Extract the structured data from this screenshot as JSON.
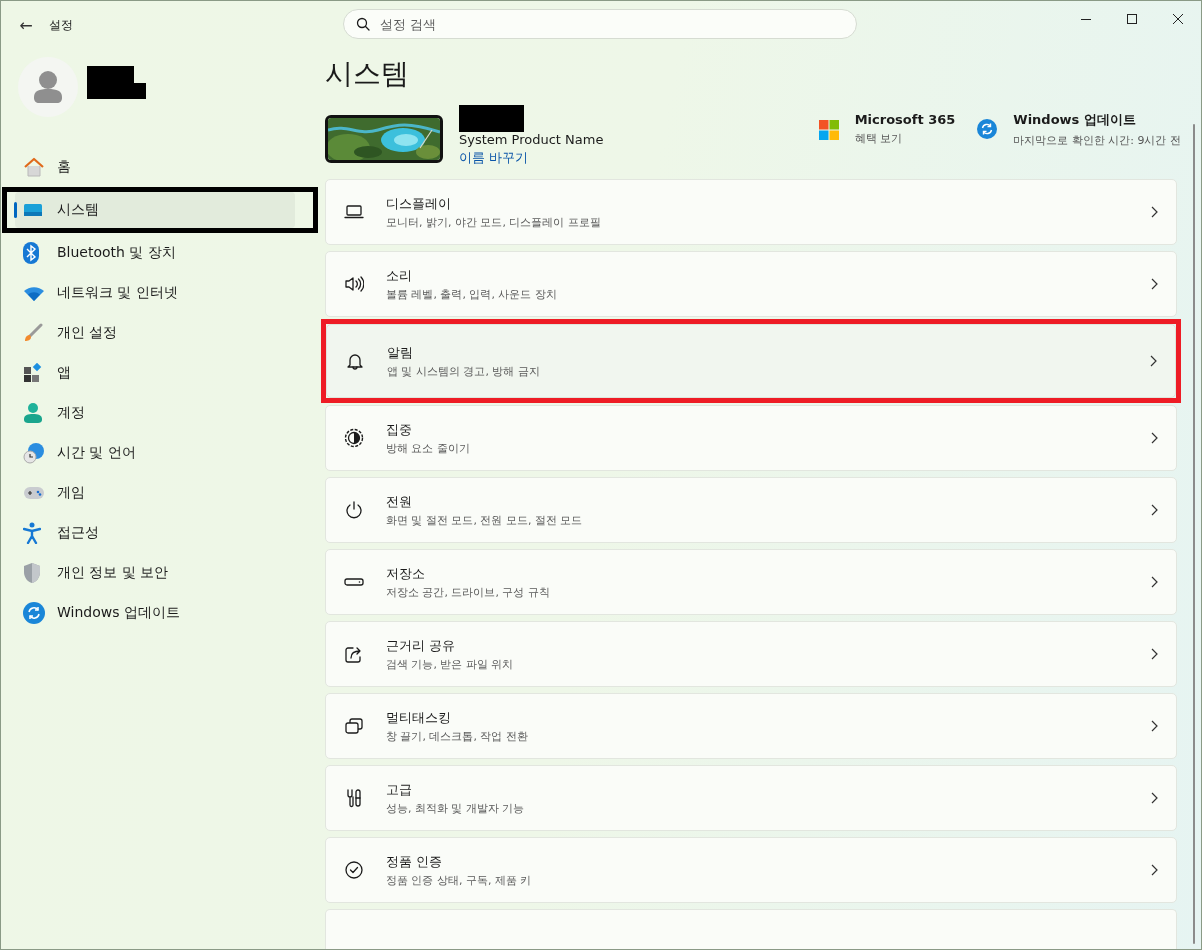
{
  "window": {
    "title": "설정",
    "back_button": "←"
  },
  "search": {
    "placeholder": "설정 검색"
  },
  "user": {
    "redacted": true
  },
  "sidebar": {
    "items": [
      {
        "label": "홈",
        "selected": false,
        "outlined": false
      },
      {
        "label": "시스템",
        "selected": true,
        "outlined": true
      },
      {
        "label": "Bluetooth 및 장치",
        "selected": false,
        "outlined": false
      },
      {
        "label": "네트워크 및 인터넷",
        "selected": false,
        "outlined": false
      },
      {
        "label": "개인 설정",
        "selected": false,
        "outlined": false
      },
      {
        "label": "앱",
        "selected": false,
        "outlined": false
      },
      {
        "label": "계정",
        "selected": false,
        "outlined": false
      },
      {
        "label": "시간 및 언어",
        "selected": false,
        "outlined": false
      },
      {
        "label": "게임",
        "selected": false,
        "outlined": false
      },
      {
        "label": "접근성",
        "selected": false,
        "outlined": false
      },
      {
        "label": "개인 정보 및 보안",
        "selected": false,
        "outlined": false
      },
      {
        "label": "Windows 업데이트",
        "selected": false,
        "outlined": false
      }
    ]
  },
  "page": {
    "title": "시스템"
  },
  "device": {
    "name_redacted": true,
    "model": "System Product Name",
    "rename_link": "이름 바꾸기"
  },
  "promos": [
    {
      "title": "Microsoft 365",
      "subtitle": "혜택 보기"
    },
    {
      "title": "Windows 업데이트",
      "subtitle": "마지막으로 확인한 시간: 9시간 전"
    }
  ],
  "settings": [
    {
      "title": "디스플레이",
      "description": "모니터, 밝기, 야간 모드, 디스플레이 프로필",
      "outlined": false
    },
    {
      "title": "소리",
      "description": "볼륨 레벨, 출력, 입력, 사운드 장치",
      "outlined": false
    },
    {
      "title": "알림",
      "description": "앱 및 시스템의 경고, 방해 금지",
      "outlined": true
    },
    {
      "title": "집중",
      "description": "방해 요소 줄이기",
      "outlined": false
    },
    {
      "title": "전원",
      "description": "화면 및 절전 모드, 전원 모드, 절전 모드",
      "outlined": false
    },
    {
      "title": "저장소",
      "description": "저장소 공간, 드라이브, 구성 규칙",
      "outlined": false
    },
    {
      "title": "근거리 공유",
      "description": "검색 기능, 받은 파일 위치",
      "outlined": false
    },
    {
      "title": "멀티태스킹",
      "description": "창 끌기, 데스크톱, 작업 전환",
      "outlined": false
    },
    {
      "title": "고급",
      "description": "성능, 최적화 및 개발자 기능",
      "outlined": false
    },
    {
      "title": "정품 인증",
      "description": "정품 인증 상태, 구독, 제품 키",
      "outlined": false
    }
  ]
}
